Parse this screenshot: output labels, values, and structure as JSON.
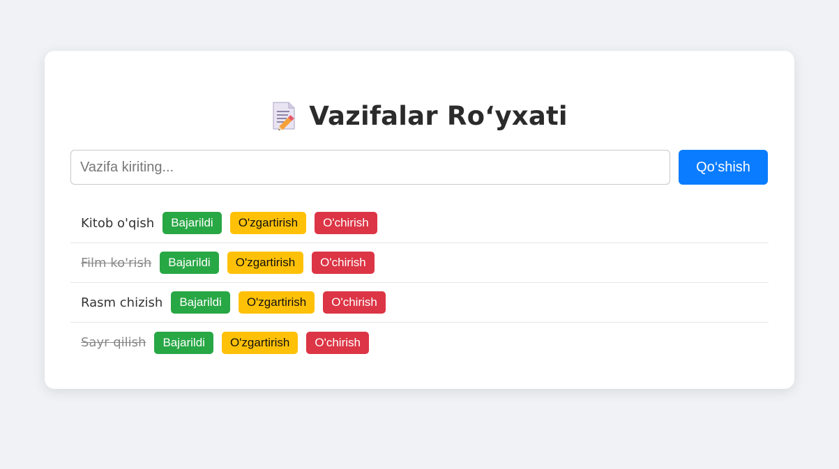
{
  "header": {
    "icon": "memo-icon",
    "title": "Vazifalar Ro‘yxati"
  },
  "form": {
    "input_placeholder": "Vazifa kiriting...",
    "input_value": "",
    "add_label": "Qo‘shish"
  },
  "colors": {
    "primary": "#0a7cff",
    "success": "#28a745",
    "warning": "#ffc107",
    "danger": "#dc3545"
  },
  "tasks": [
    {
      "text": "Kitob o'qish",
      "done": false,
      "done_label": "Bajarildi",
      "edit_label": "O'zgartirish",
      "delete_label": "O'chirish"
    },
    {
      "text": "Film ko'rish",
      "done": true,
      "done_label": "Bajarildi",
      "edit_label": "O'zgartirish",
      "delete_label": "O'chirish"
    },
    {
      "text": "Rasm chizish",
      "done": false,
      "done_label": "Bajarildi",
      "edit_label": "O'zgartirish",
      "delete_label": "O'chirish"
    },
    {
      "text": "Sayr qilish",
      "done": true,
      "done_label": "Bajarildi",
      "edit_label": "O'zgartirish",
      "delete_label": "O'chirish"
    }
  ]
}
